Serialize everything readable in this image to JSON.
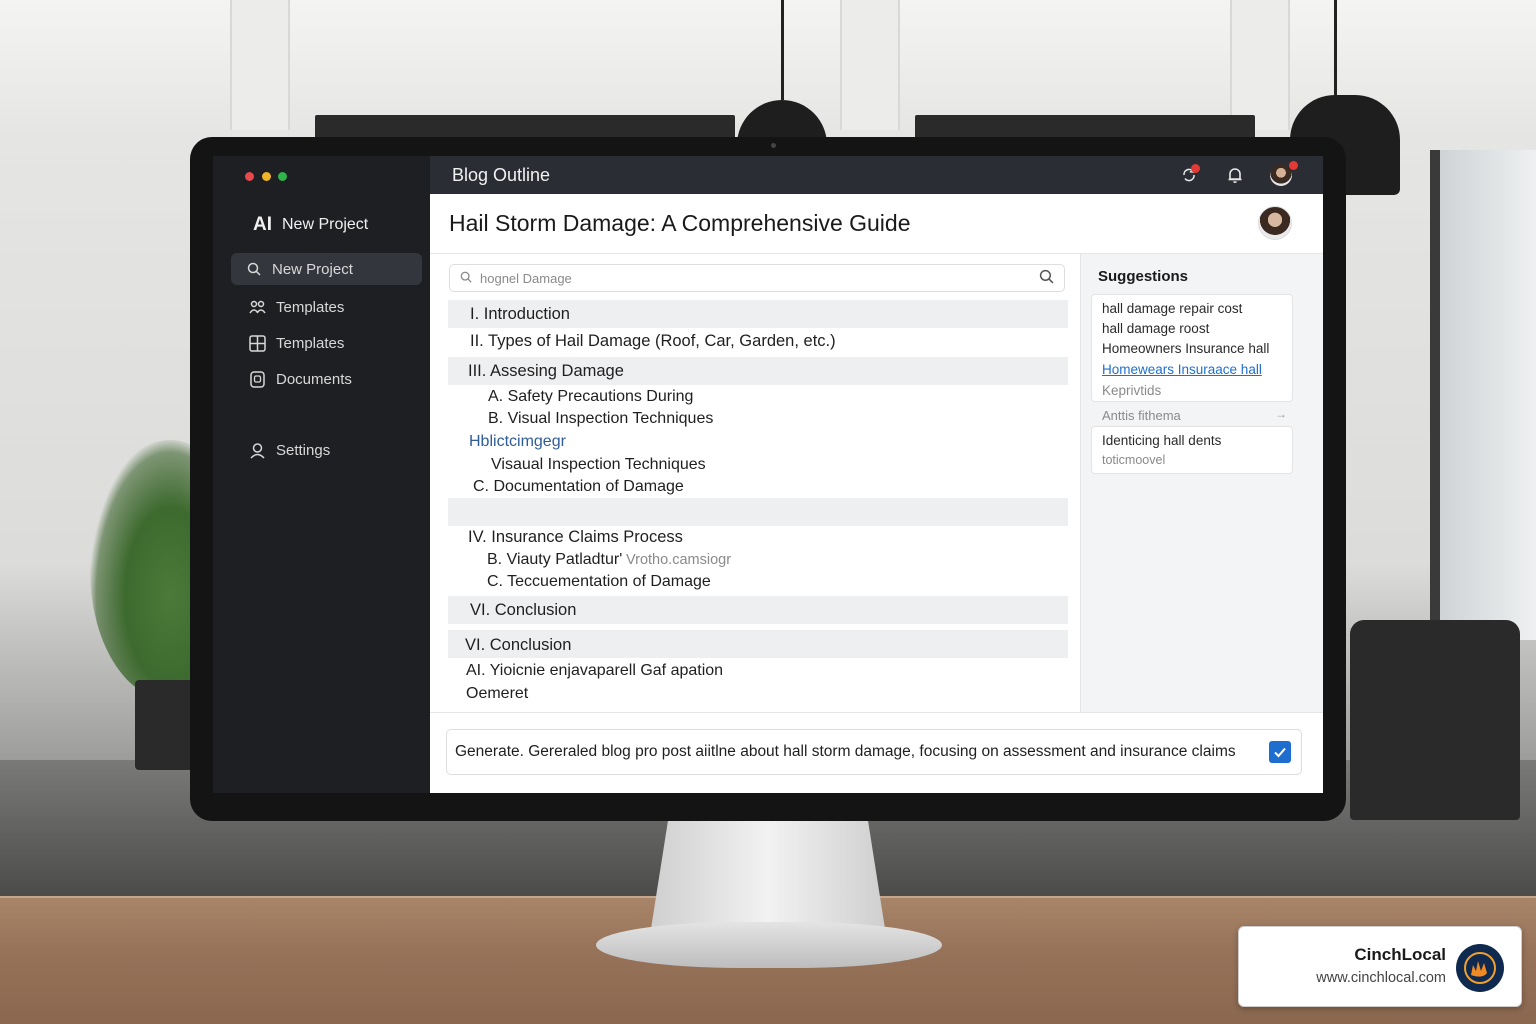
{
  "sidebar": {
    "brand_logo": "AI",
    "brand_name": "New Project",
    "items": [
      {
        "label": "New Project",
        "icon": "search-icon",
        "active": true
      },
      {
        "label": "Templates",
        "icon": "people-icon",
        "active": false
      },
      {
        "label": "Templates",
        "icon": "grid-icon",
        "active": false
      },
      {
        "label": "Documents",
        "icon": "document-icon",
        "active": false
      },
      {
        "label": "Settings",
        "icon": "user-gear-icon",
        "active": false
      }
    ]
  },
  "topbar": {
    "title": "Blog Outline",
    "icons": [
      "sync-icon",
      "bell-icon",
      "avatar-icon"
    ]
  },
  "header": {
    "title": "Hail Storm Damage: A Comprehensive Guide"
  },
  "search": {
    "placeholder": "hognel Damage"
  },
  "outline": [
    "I. Introduction",
    "II. Types of Hail Damage (Roof, Car, Garden, etc.)",
    "III. Assesing Damage",
    "A. Safety Precautions During",
    "B. Visual Inspection Techniques",
    "Hblictcimgegr",
    "Visaual Inspection Techniques",
    "C. Documentation of Damage",
    "IV. Insurance Claims Process",
    "B. Viauty Patladtur'",
    "Vrotho.camsiogr",
    "C. Teccuementation of Damage",
    "VI. Conclusion",
    "VI. Conclusion",
    "AI. Yioicnie enjavaparell Gaf apation",
    "Oemeret"
  ],
  "suggestions": {
    "title": "Suggestions",
    "card1": [
      "hall damage repair cost",
      "hall damage roost",
      "Homeowners Insurance hall",
      "Homewears Insuraace hall",
      "Keprivtids"
    ],
    "middle": "Anttis fithema",
    "middle_arrow": "→",
    "card2": [
      "Identicing hall dents",
      "toticmoovel"
    ]
  },
  "prompt": {
    "text": "Generate. Gereraled blog pro post aiitlne about hall storm damage, focusing on assessment and insurance claims",
    "checked": true
  },
  "badge": {
    "name": "CinchLocal",
    "url": "www.cinchlocal.com"
  },
  "colors": {
    "sidebar_bg": "#1d1f23",
    "topbar_bg": "#2a2d33",
    "accent": "#1e6ed0",
    "link": "#1f6fd0",
    "notification": "#e53935"
  }
}
